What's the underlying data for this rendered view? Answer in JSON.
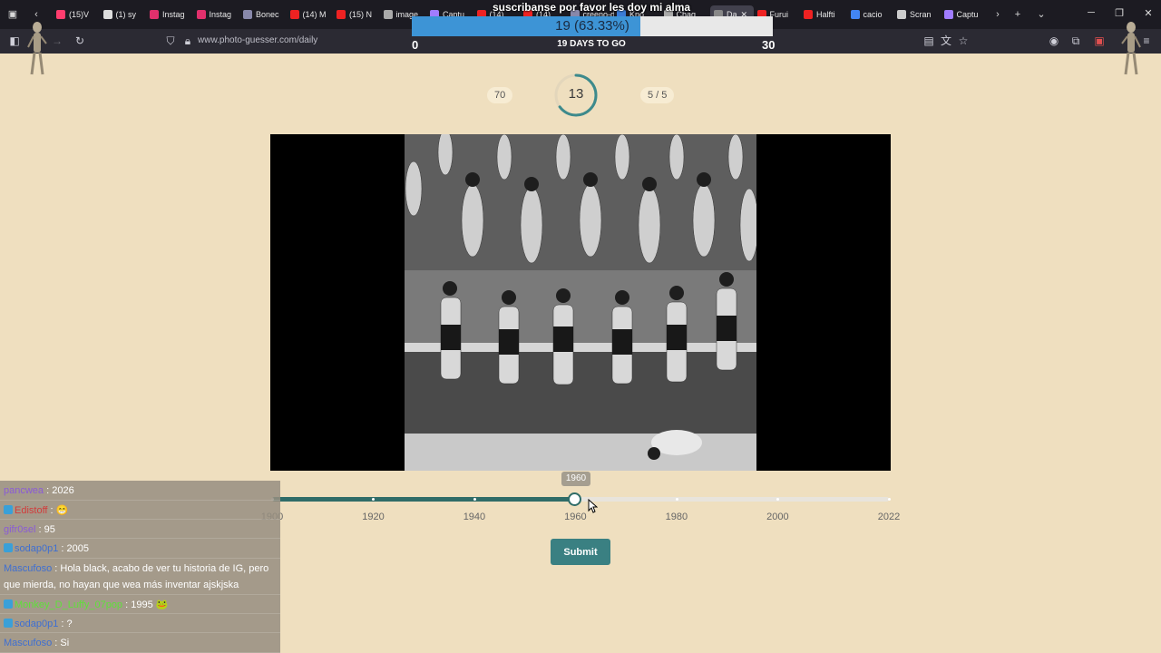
{
  "browser": {
    "tabs": [
      "(15)V",
      "(1) sy",
      "Instag",
      "Instag",
      "Bonec",
      "(14) M",
      "(15) N",
      "image",
      "Captu",
      "(14)",
      "(14)",
      "creeno-de",
      "Kno",
      "Chag",
      "Da",
      "Furui",
      "Halfti",
      "cacio",
      "Scran",
      "Captu"
    ],
    "url": "www.photo-guesser.com/daily"
  },
  "goal": {
    "title": "suscribanse por favor les doy mi alma",
    "progress_text": "19 (63.33%)",
    "progress_fraction": 0.6333,
    "min": "0",
    "max": "30",
    "days_left": "19 DAYS TO GO"
  },
  "game": {
    "score": "70",
    "timer": "13",
    "timer_fraction": 0.65,
    "round": "5 / 5",
    "photo_alt": "Historical black-and-white photograph of a beauty pageant lineup"
  },
  "slider": {
    "tooltip": "1960",
    "value": 1960,
    "min": 1900,
    "max": 2022,
    "ticks": [
      "1900",
      "1920",
      "1940",
      "1960",
      "1980",
      "2000",
      "2022"
    ],
    "tick_values": [
      1900,
      1920,
      1940,
      1960,
      1980,
      2000,
      2022
    ]
  },
  "submit_label": "Submit",
  "chat": [
    {
      "user": "pancwea",
      "color": "#8a5bd6",
      "text": " : 2026"
    },
    {
      "user": "Edistoff",
      "color": "#d23b3b",
      "text": " : 😁"
    },
    {
      "user": "gifr0sel",
      "color": "#8a5bd6",
      "text": " : 95"
    },
    {
      "user": "sodap0p1",
      "color": "#3f6fd1",
      "text": " : 2005"
    },
    {
      "user": "Mascufoso",
      "color": "#3f6fd1",
      "text": " : Hola black, acabo de ver tu historia de IG, pero que mierda, no hayan que wea más inventar ajskjska"
    },
    {
      "user": "Monkey_D_Luffy_07pop",
      "color": "#5fe03a",
      "text": " : 1995 🐸"
    },
    {
      "user": "sodap0p1",
      "color": "#3f6fd1",
      "text": " : ?"
    },
    {
      "user": "Mascufoso",
      "color": "#3f6fd1",
      "text": " : Si"
    }
  ]
}
